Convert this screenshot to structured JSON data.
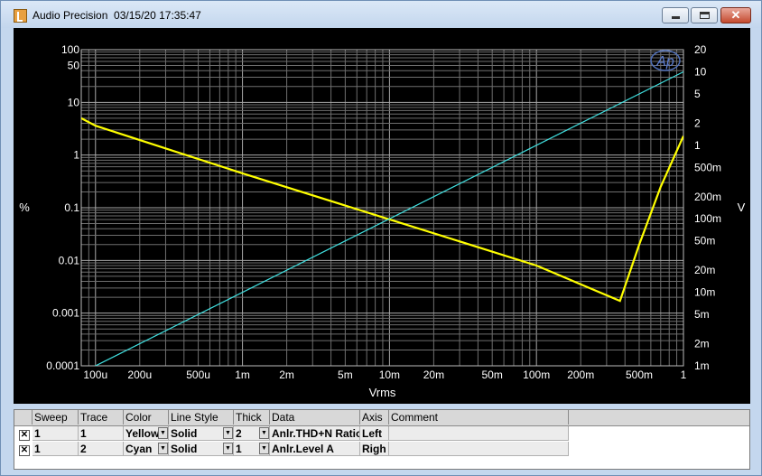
{
  "window": {
    "title": "Audio Precision  03/15/20 17:35:47",
    "logo": "Ap"
  },
  "chart_data": {
    "type": "line",
    "xlabel": "Vrms",
    "ylabel_left": "%",
    "ylabel_right": "V",
    "x_scale": "log",
    "y_scale": "log",
    "xlim": [
      8e-05,
      1.0
    ],
    "ylim_left": [
      0.0001,
      100
    ],
    "ylim_right": [
      0.001,
      20
    ],
    "grid": true,
    "x_ticks": [
      {
        "v": 0.0001,
        "label": "100u"
      },
      {
        "v": 0.0002,
        "label": "200u"
      },
      {
        "v": 0.0005,
        "label": "500u"
      },
      {
        "v": 0.001,
        "label": "1m"
      },
      {
        "v": 0.002,
        "label": "2m"
      },
      {
        "v": 0.005,
        "label": "5m"
      },
      {
        "v": 0.01,
        "label": "10m"
      },
      {
        "v": 0.02,
        "label": "20m"
      },
      {
        "v": 0.05,
        "label": "50m"
      },
      {
        "v": 0.1,
        "label": "100m"
      },
      {
        "v": 0.2,
        "label": "200m"
      },
      {
        "v": 0.5,
        "label": "500m"
      },
      {
        "v": 1,
        "label": "1"
      }
    ],
    "y_ticks_left": [
      {
        "v": 0.0001,
        "label": "0.0001"
      },
      {
        "v": 0.001,
        "label": "0.001"
      },
      {
        "v": 0.01,
        "label": "0.01"
      },
      {
        "v": 0.1,
        "label": "0.1"
      },
      {
        "v": 1,
        "label": "1"
      },
      {
        "v": 10,
        "label": "10"
      },
      {
        "v": 50,
        "label": "50"
      },
      {
        "v": 100,
        "label": "100"
      }
    ],
    "y_ticks_right": [
      {
        "v": 0.001,
        "label": "1m"
      },
      {
        "v": 0.002,
        "label": "2m"
      },
      {
        "v": 0.005,
        "label": "5m"
      },
      {
        "v": 0.01,
        "label": "10m"
      },
      {
        "v": 0.02,
        "label": "20m"
      },
      {
        "v": 0.05,
        "label": "50m"
      },
      {
        "v": 0.1,
        "label": "100m"
      },
      {
        "v": 0.2,
        "label": "200m"
      },
      {
        "v": 0.5,
        "label": "500m"
      },
      {
        "v": 1,
        "label": "1"
      },
      {
        "v": 2,
        "label": "2"
      },
      {
        "v": 5,
        "label": "5"
      },
      {
        "v": 10,
        "label": "10"
      },
      {
        "v": 20,
        "label": "20"
      }
    ],
    "series": [
      {
        "name": "Anlr.THD+N Ratio",
        "axis": "left",
        "color": "#ffff00",
        "x": [
          8e-05,
          0.0001,
          0.001,
          0.01,
          0.1,
          0.37,
          0.5,
          0.7,
          1.0
        ],
        "y": [
          5.0,
          3.6,
          0.45,
          0.06,
          0.008,
          0.0017,
          0.02,
          0.25,
          2.3
        ]
      },
      {
        "name": "Anlr.Level A",
        "axis": "right",
        "color": "#40e0e0",
        "x": [
          8e-05,
          1.0
        ],
        "y": [
          0.0008,
          10
        ]
      }
    ]
  },
  "table": {
    "headers": [
      "Sweep",
      "Trace",
      "Color",
      "Line Style",
      "Thick",
      "Data",
      "Axis",
      "Comment"
    ],
    "rows": [
      {
        "sweep": "1",
        "trace": "1",
        "color": "Yellow",
        "style": "Solid",
        "thick": "2",
        "data": "Anlr.THD+N Ratio",
        "axis": "Left",
        "comment": ""
      },
      {
        "sweep": "1",
        "trace": "2",
        "color": "Cyan",
        "style": "Solid",
        "thick": "1",
        "data": "Anlr.Level A",
        "axis": "Righ",
        "comment": ""
      }
    ]
  }
}
